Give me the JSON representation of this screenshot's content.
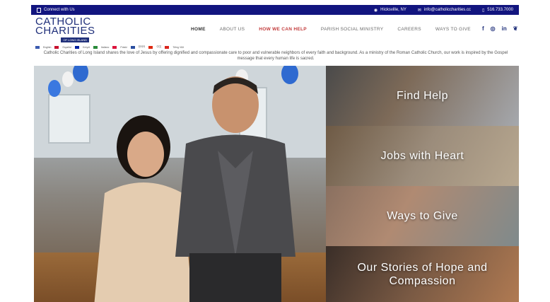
{
  "topbar": {
    "connect": "Connect with Us",
    "location": "Hicksville, NY",
    "email": "info@catholiccharities.cc",
    "phone": "516.733.7000"
  },
  "logo": {
    "line1": "CATHOLIC",
    "line2": "CHARITIES",
    "line3": "OF LONG ISLAND"
  },
  "nav": [
    {
      "label": "HOME"
    },
    {
      "label": "ABOUT US"
    },
    {
      "label": "HOW WE CAN HELP"
    },
    {
      "label": "PARISH SOCIAL MINISTRY"
    },
    {
      "label": "CAREERS"
    },
    {
      "label": "WAYS TO GIVE"
    }
  ],
  "social": [
    "f",
    "ig",
    "in",
    "tw"
  ],
  "languages": [
    "English",
    "Español",
    "Kreyòl",
    "Italiano",
    "Polski",
    "한국어",
    "中文",
    "Tiếng Việt"
  ],
  "mission": "Catholic Charities of Long Island shares the love of Jesus by offering dignified and compassionate care to poor and vulnerable neighbors of every faith and background. As a ministry of the Roman Catholic Church, our work is inspired by the Gospel message that every human life is sacred.",
  "tiles": [
    {
      "label": "Find Help"
    },
    {
      "label": "Jobs with Heart"
    },
    {
      "label": "Ways to Give"
    },
    {
      "label": "Our Stories of Hope and Compassion"
    }
  ],
  "colors": {
    "topbar": "#12157f",
    "brand": "#1f2f7a",
    "accent_red": "#c23b3b"
  }
}
